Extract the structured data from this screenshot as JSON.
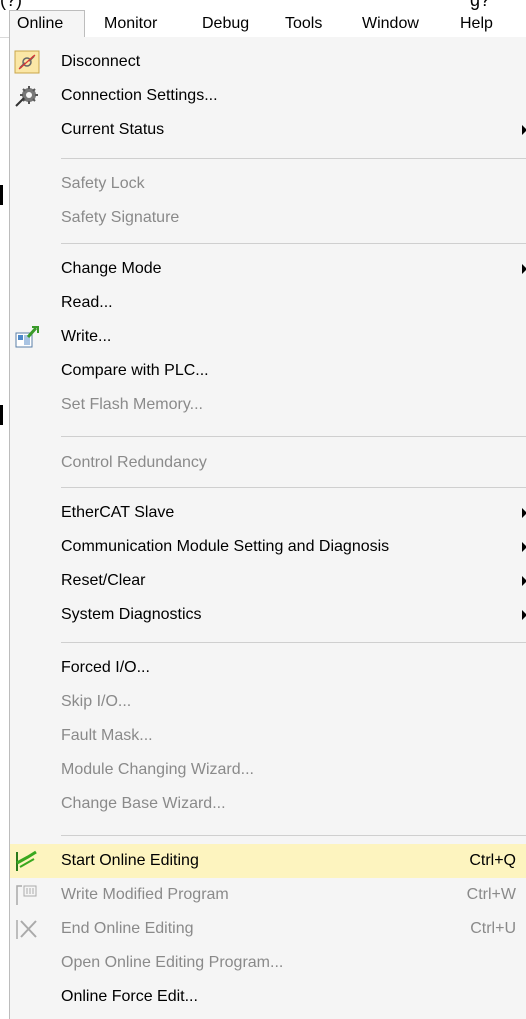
{
  "top_fragment": {
    "left": "(?)",
    "right": "g?"
  },
  "menubar": {
    "items": [
      {
        "label": "Online",
        "active": true
      },
      {
        "label": "Monitor"
      },
      {
        "label": "Debug"
      },
      {
        "label": "Tools"
      },
      {
        "label": "Window"
      },
      {
        "label": "Help"
      }
    ]
  },
  "menu": {
    "items": [
      {
        "label": "Disconnect",
        "icon": "disconnect-icon"
      },
      {
        "label": "Connection Settings...",
        "icon": "connection-settings-icon"
      },
      {
        "label": "Current Status",
        "submenu": true
      },
      {
        "label": "Safety Lock",
        "disabled": true
      },
      {
        "label": "Safety Signature",
        "disabled": true
      },
      {
        "label": "Change Mode",
        "submenu": true
      },
      {
        "label": "Read..."
      },
      {
        "label": "Write...",
        "icon": "write-to-plc-icon"
      },
      {
        "label": "Compare with PLC..."
      },
      {
        "label": "Set Flash Memory...",
        "disabled": true
      },
      {
        "label": "Control Redundancy",
        "disabled": true
      },
      {
        "label": "EtherCAT Slave",
        "submenu": true
      },
      {
        "label": "Communication Module Setting and Diagnosis",
        "submenu": true
      },
      {
        "label": "Reset/Clear",
        "submenu": true
      },
      {
        "label": "System Diagnostics",
        "submenu": true
      },
      {
        "label": "Forced I/O..."
      },
      {
        "label": "Skip I/O...",
        "disabled": true
      },
      {
        "label": "Fault Mask...",
        "disabled": true
      },
      {
        "label": "Module Changing Wizard...",
        "disabled": true
      },
      {
        "label": "Change Base Wizard...",
        "disabled": true
      },
      {
        "label": "Start Online Editing",
        "shortcut": "Ctrl+Q",
        "icon": "start-online-editing-icon",
        "highlighted": true
      },
      {
        "label": "Write Modified Program",
        "shortcut": "Ctrl+W",
        "icon": "write-modified-program-icon",
        "disabled": true
      },
      {
        "label": "End Online Editing",
        "shortcut": "Ctrl+U",
        "icon": "end-online-editing-icon",
        "disabled": true
      },
      {
        "label": "Open Online Editing Program...",
        "disabled": true
      },
      {
        "label": "Online Force Edit..."
      }
    ]
  },
  "colors": {
    "menu_background": "#f5f5f5",
    "highlight": "#fdf4bf",
    "disabled_text": "#8a8a8a",
    "separator": "#cfcfcf"
  }
}
